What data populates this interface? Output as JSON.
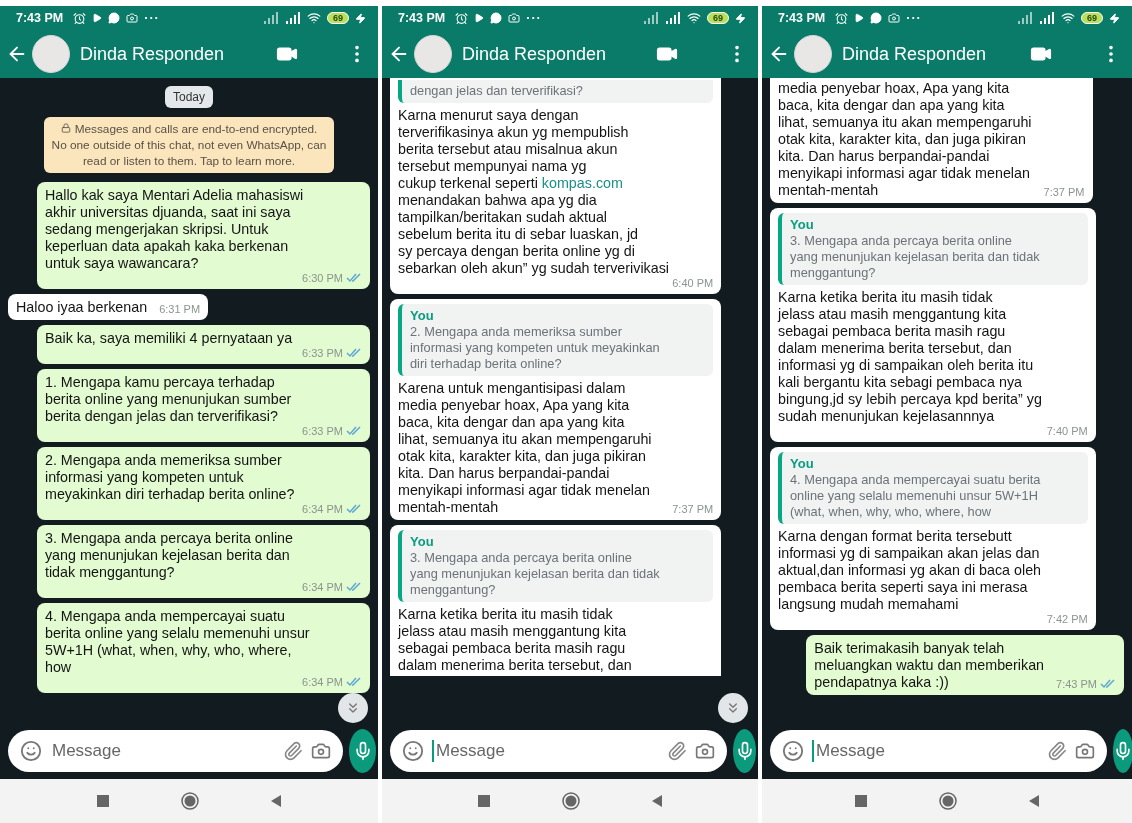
{
  "panels": [
    {
      "status_time": "7:43 PM",
      "status_more": "···",
      "battery": "69",
      "contact": "Dinda Responden",
      "scroll_button": true,
      "composer": {
        "placeholder": "Message",
        "focused": false
      },
      "messages": [
        {
          "kind": "date",
          "text": "Today"
        },
        {
          "kind": "system",
          "text": "Messages and calls are end-to-end encrypted.\nNo one outside of this chat, not even WhatsApp, can\nread or listen to them. Tap to learn more."
        },
        {
          "kind": "out",
          "text": "Hallo kak saya Mentari Adelia mahasiswi\nakhir universitas djuanda, saat ini saya\nsedang mengerjakan skripsi. Untuk\nkeperluan data apakah kaka berkenan\nuntuk saya wawancara?",
          "time": "6:30 PM",
          "read": true
        },
        {
          "kind": "in",
          "text": "Haloo iyaa berkenan",
          "time": "6:31 PM"
        },
        {
          "kind": "out",
          "text": "Baik ka, saya memiliki 4 pernyataan ya",
          "time": "6:33 PM",
          "read": true
        },
        {
          "kind": "out",
          "text": "1. Mengapa kamu percaya terhadap\nberita online yang menunjukan sumber\nberita dengan jelas dan terverifikasi?",
          "time": "6:33 PM",
          "read": true
        },
        {
          "kind": "out",
          "text": "2. Mengapa anda memeriksa sumber\ninformasi yang kompeten untuk\nmeyakinkan diri terhadap berita online?",
          "time": "6:34 PM",
          "read": true
        },
        {
          "kind": "out",
          "text": "3. Mengapa anda percaya berita online\nyang menunjukan kejelasan berita dan\ntidak menggantung?",
          "time": "6:34 PM",
          "read": true
        },
        {
          "kind": "out",
          "text": "4. Mengapa anda mempercayai suatu\nberita online yang selalu memenuhi unsur\n5W+1H (what, when, why, who, where,\nhow",
          "time": "6:34 PM",
          "read": true
        }
      ]
    },
    {
      "status_time": "7:43 PM",
      "status_more": "···",
      "battery": "69",
      "contact": "Dinda Responden",
      "scroll_button": true,
      "composer": {
        "placeholder": "Message",
        "focused": true
      },
      "messages": [
        {
          "kind": "reply",
          "clipped_top": true,
          "quote": "dengan jelas dan terverifikasi?",
          "segments": [
            {
              "kind": "plain",
              "text": "Karna menurut saya dengan\nterverifikasinya akun yg mempublish\nberita tersebut atau misalnua akun\ntersebut mempunyai nama yg\ncukup terkenal seperti "
            },
            {
              "kind": "link",
              "text": "kompas.com"
            },
            {
              "kind": "plain",
              "text": "\nmenandakan bahwa apa yg dia\ntampilkan/beritakan sudah aktual\nsebelum berita itu di sebar luaskan, jd\nsy percaya dengan berita online yg di\nsebarkan oleh akun” yg sudah terverivikasi"
            }
          ],
          "time": "6:40 PM"
        },
        {
          "kind": "reply",
          "author": "You",
          "quote": "2. Mengapa anda memeriksa sumber\ninformasi yang kompeten untuk meyakinkan\ndiri terhadap berita online?",
          "text": "Karena untuk mengantisipasi dalam\nmedia penyebar hoax, Apa yang kita\nbaca, kita dengar dan apa yang kita\nlihat, semuanya itu akan mempengaruhi\notak kita, karakter kita, dan juga pikiran\nkita. Dan harus berpandai-pandai\nmenyikapi informasi agar tidak menelan\nmentah-mentah",
          "time": "7:37 PM"
        },
        {
          "kind": "reply",
          "author": "You",
          "clipped_bottom": true,
          "quote": "3. Mengapa anda percaya berita online\nyang menunjukan kejelasan berita dan tidak\nmenggantung?",
          "text": "Karna ketika berita itu masih tidak\njelass atau masih menggantung kita\nsebagai pembaca berita masih ragu\ndalam menerima berita tersebut, dan"
        }
      ]
    },
    {
      "status_time": "7:43 PM",
      "status_more": "···",
      "battery": "69",
      "contact": "Dinda Responden",
      "scroll_button": false,
      "composer": {
        "placeholder": "Message",
        "focused": true
      },
      "messages": [
        {
          "kind": "in",
          "clipped_top": true,
          "text": "media penyebar hoax, Apa yang kita\nbaca, kita dengar dan apa yang kita\nlihat, semuanya itu akan mempengaruhi\notak kita, karakter kita, dan juga pikiran\nkita. Dan harus berpandai-pandai\nmenyikapi informasi agar tidak menelan\nmentah-mentah",
          "time": "7:37 PM"
        },
        {
          "kind": "reply",
          "author": "You",
          "quote": "3. Mengapa anda percaya berita online\nyang menunjukan kejelasan berita dan tidak\nmenggantung?",
          "text": "Karna ketika berita itu masih tidak\njelass atau masih menggantung kita\nsebagai pembaca berita masih ragu\ndalam menerima berita tersebut, dan\ninformasi yg di sampaikan oleh berita itu\nkali bergantu kita sebagi pembaca nya\nbingung,jd sy lebih percaya kpd berita” yg\nsudah menunjukan kejelasannnya",
          "time": "7:40 PM"
        },
        {
          "kind": "reply",
          "author": "You",
          "quote": "4. Mengapa anda mempercayai suatu berita\nonline yang selalu memenuhi unsur 5W+1H\n(what, when, why, who, where, how",
          "text": "Karna dengan format berita tersebutt\ninformasi yg di sampaikan akan jelas dan\naktual,dan informasi yg akan di baca oleh\npembaca berita seperti saya ini merasa\nlangsung mudah memahami",
          "time": "7:42 PM"
        },
        {
          "kind": "out",
          "text": "Baik terimakasih banyak telah\nmeluangkan waktu dan memberikan\npendapatnya kaka :))",
          "time": "7:43 PM",
          "read": true
        }
      ]
    }
  ]
}
